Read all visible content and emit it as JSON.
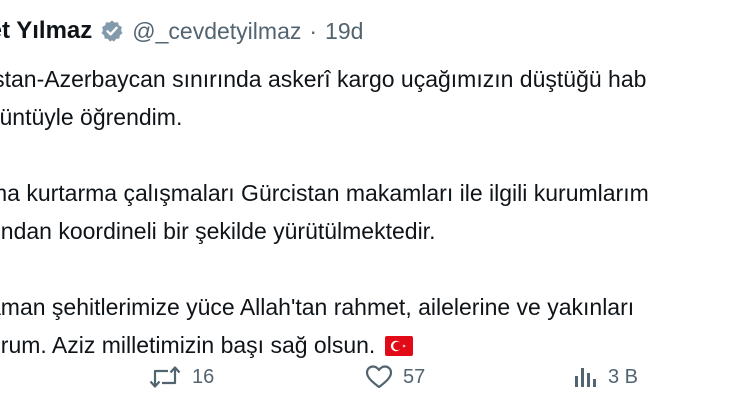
{
  "tweet": {
    "author": {
      "display_name": "let Yılmaz",
      "handle": "@_cevdetyilmaz",
      "verified_icon": "verified-badge-icon"
    },
    "separator": "·",
    "time": "19d",
    "paragraphs": [
      [
        "istan-Azerbaycan sınırında askerî kargo uçağımızın düştüğü hab",
        "züntüyle öğrendim."
      ],
      [
        "ma kurtarma çalışmaları Gürcistan makamları ile ilgili kurumlarım",
        "undan koordineli bir şekilde yürütülmektedir."
      ],
      [
        "aman şehitlerimize yüce Allah'tan rahmet, ailelerine ve yakınları",
        "orum. Aziz milletimizin başı sağ olsun."
      ]
    ],
    "flag_icon": "turkish-flag-icon",
    "actions": {
      "retweet_count": "16",
      "like_count": "57",
      "views_count": "3 B"
    },
    "colors": {
      "text": "#0f1419",
      "secondary": "#536471",
      "verified": "#829aab",
      "flag": "#e30a17"
    }
  }
}
